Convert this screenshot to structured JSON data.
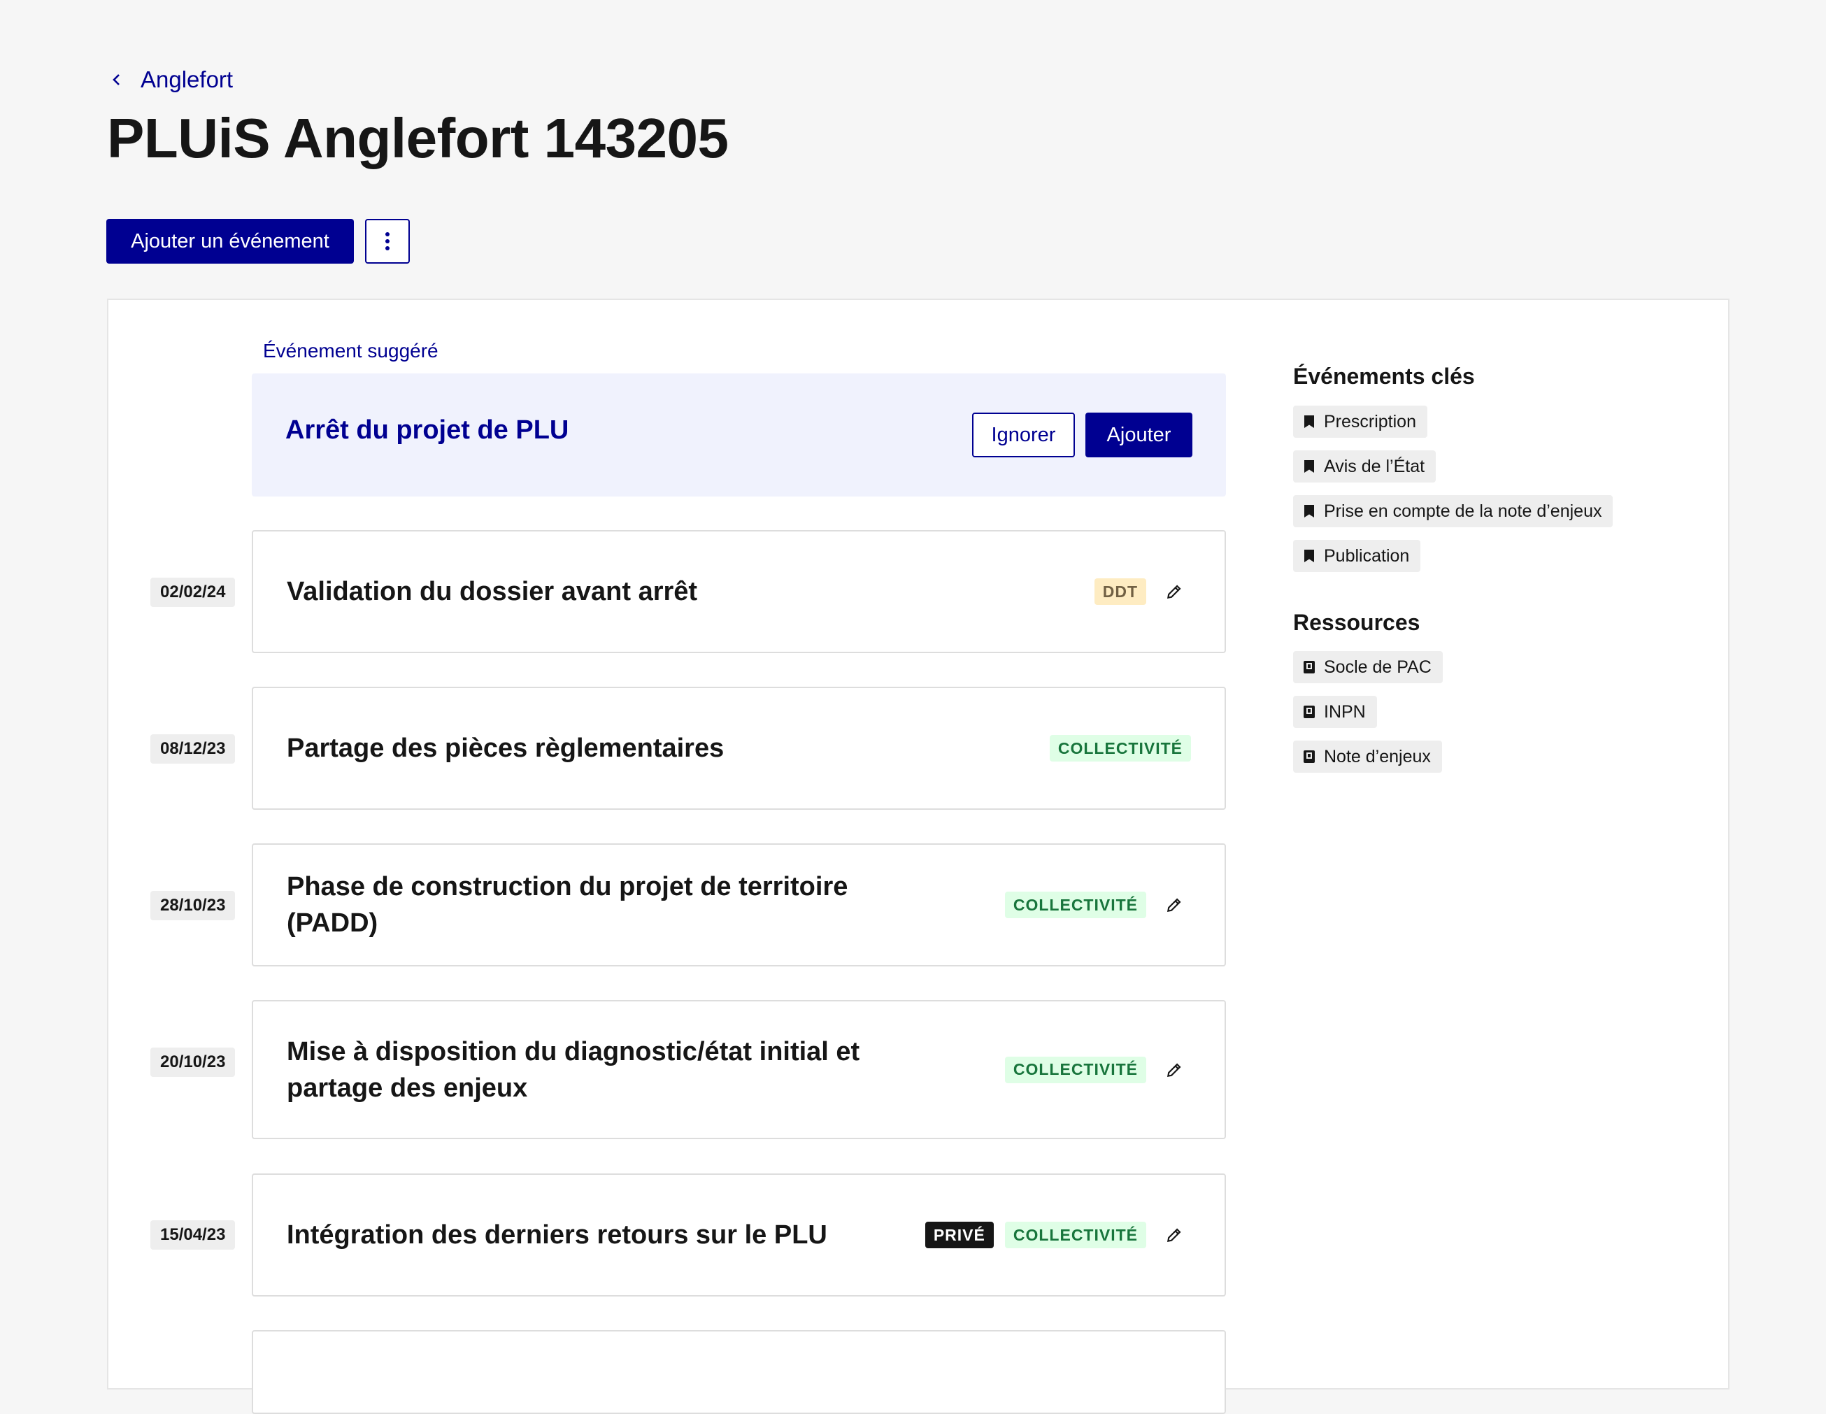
{
  "breadcrumb": {
    "back_label": "Anglefort"
  },
  "page": {
    "title": "PLUiS Anglefort 143205"
  },
  "toolbar": {
    "add_event_label": "Ajouter un événement",
    "more_icon": "more-vertical-icon"
  },
  "suggestion": {
    "label": "Événement suggéré",
    "title": "Arrêt du projet de PLU",
    "ignore_label": "Ignorer",
    "add_label": "Ajouter"
  },
  "events": [
    {
      "date": "02/02/24",
      "title": "Validation du dossier avant arrêt",
      "badges": [
        "DDT"
      ]
    },
    {
      "date": "08/12/23",
      "title": "Partage des pièces règlementaires",
      "badges": [
        "COLLECTIVITÉ"
      ]
    },
    {
      "date": "28/10/23",
      "title": "Phase de construction du projet de territoire (PADD)",
      "badges": [
        "COLLECTIVITÉ"
      ]
    },
    {
      "date": "20/10/23",
      "title": "Mise à disposition du diagnostic/état initial et partage des enjeux",
      "badges": [
        "COLLECTIVITÉ"
      ]
    },
    {
      "date": "15/04/23",
      "title": "Intégration des derniers retours sur le PLU",
      "badges": [
        "PRIVÉ",
        "COLLECTIVITÉ"
      ]
    }
  ],
  "sidebar": {
    "key_events_heading": "Événements clés",
    "key_events": [
      "Prescription",
      "Avis de l’État",
      "Prise en compte de la note d’enjeux",
      "Publication"
    ],
    "resources_heading": "Ressources",
    "resources": [
      "Socle de PAC",
      "INPN",
      "Note d’enjeux"
    ]
  },
  "colors": {
    "primary": "#000091",
    "background": "#f6f6f6",
    "suggestion_bg": "#f0f2fd",
    "badge_ddt_bg": "#feecc2",
    "badge_collectivite_bg": "#dffee6",
    "badge_prive_bg": "#161616"
  }
}
